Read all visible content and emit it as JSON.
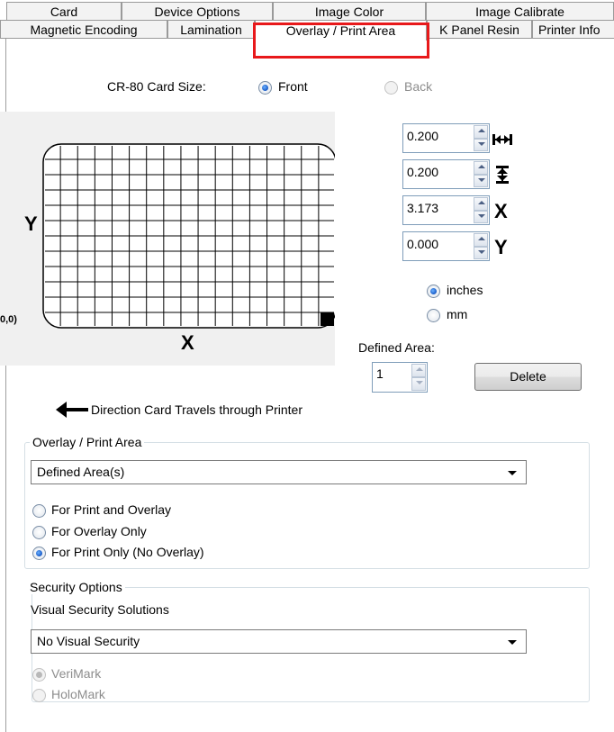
{
  "tabs": {
    "row1": [
      "Card",
      "Device Options",
      "Image Color",
      "Image Calibrate"
    ],
    "row2": [
      "Magnetic Encoding",
      "Lamination",
      "Overlay / Print Area",
      "K Panel Resin",
      "Printer Info"
    ],
    "active": "Overlay / Print Area"
  },
  "card_size": {
    "label": "CR-80 Card Size:",
    "front": "Front",
    "back": "Back",
    "selected": "Front"
  },
  "preview": {
    "y_label": "Y",
    "x_label": "X",
    "origin_label": "0,0)",
    "grid_rows": 12,
    "grid_cols": 17
  },
  "spinners": {
    "width": {
      "value": "0.200",
      "icon": "width-arrows-icon"
    },
    "height": {
      "value": "0.200",
      "icon": "height-arrows-icon"
    },
    "x": {
      "value": "3.173",
      "icon": "x-letter-icon"
    },
    "y": {
      "value": "0.000",
      "icon": "y-letter-icon"
    }
  },
  "units": {
    "inches": "inches",
    "mm": "mm",
    "selected": "inches"
  },
  "defined_area": {
    "label": "Defined Area:",
    "value": "1",
    "delete_label": "Delete"
  },
  "direction": {
    "text": "Direction Card Travels through Printer"
  },
  "overlay_group": {
    "title": "Overlay / Print Area",
    "combo_value": "Defined Area(s)",
    "options": [
      "For Print and Overlay",
      "For Overlay Only",
      "For Print Only (No Overlay)"
    ],
    "selected": "For Print Only (No Overlay)"
  },
  "security_group": {
    "title": "Security Options",
    "sub_label": "Visual Security Solutions",
    "combo_value": "No Visual Security",
    "options": [
      "VeriMark",
      "HoloMark"
    ],
    "selected": "VeriMark"
  },
  "colors": {
    "highlight": "#e8191b",
    "radio_selected": "#1759c6",
    "preview_bg": "#f0f0f0",
    "disabled_text": "#8d8d8d"
  }
}
